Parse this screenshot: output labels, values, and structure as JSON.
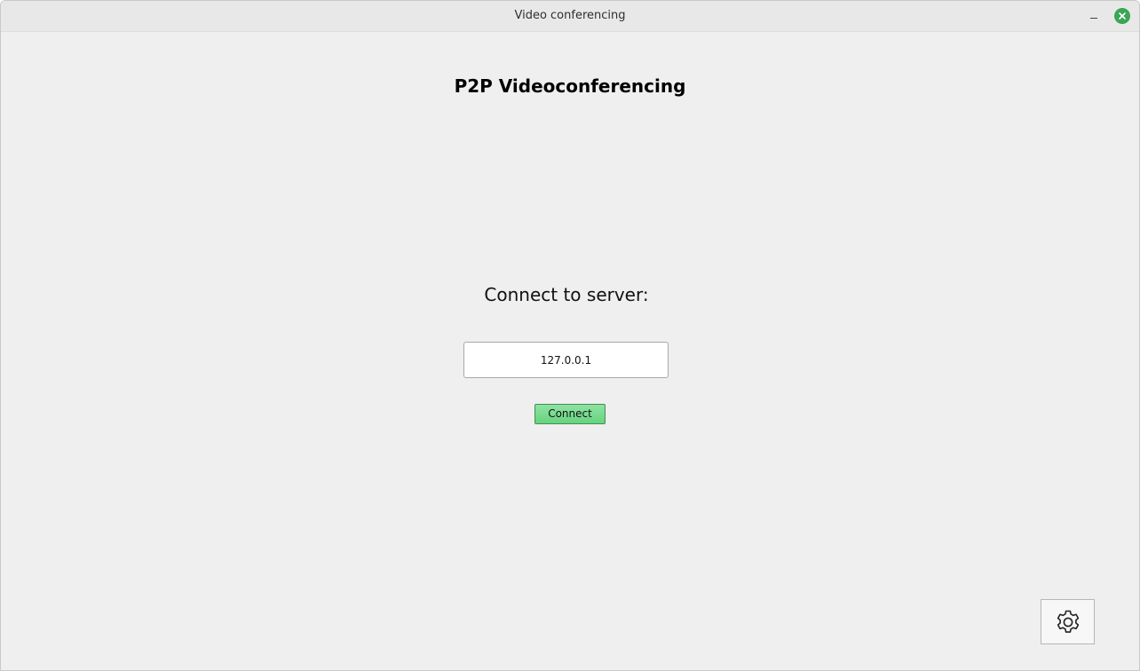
{
  "window": {
    "title": "Video conferencing",
    "close_color": "#3aa655"
  },
  "app": {
    "title": "P2P Videoconferencing",
    "connect_label": "Connect to server:",
    "server_input": {
      "value": "127.0.0.1",
      "placeholder": ""
    },
    "connect_button": "Connect",
    "connect_button_color": "#66d37f",
    "settings_icon": "gear-icon"
  }
}
